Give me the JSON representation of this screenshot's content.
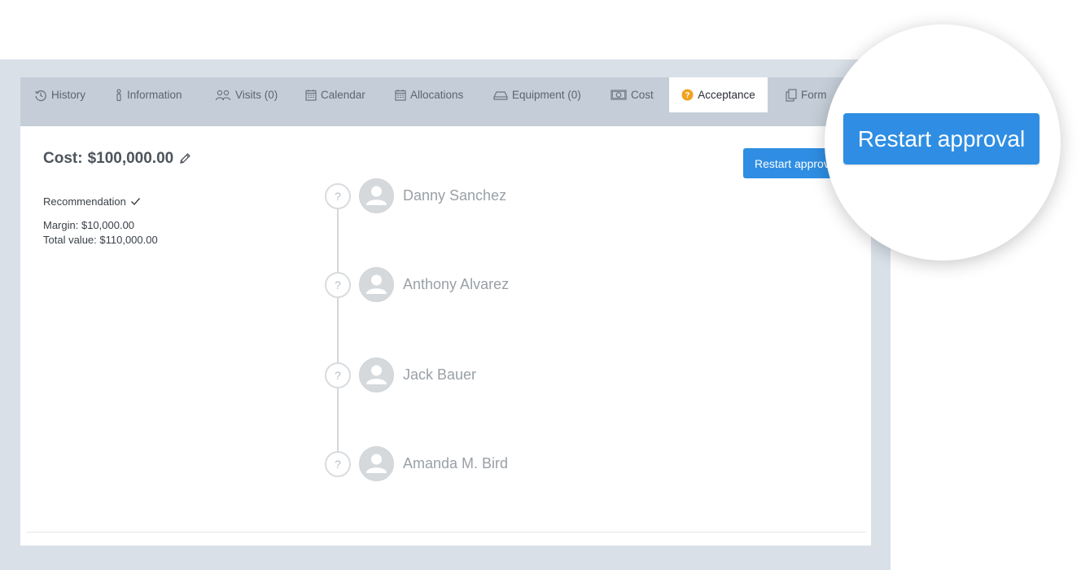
{
  "tabs": [
    {
      "label": "History",
      "icon": "history-icon"
    },
    {
      "label": "Information",
      "icon": "info-icon"
    },
    {
      "label": "Visits (0)",
      "icon": "users-icon"
    },
    {
      "label": "Calendar",
      "icon": "calendar-icon"
    },
    {
      "label": "Allocations",
      "icon": "calendar-grid-icon"
    },
    {
      "label": "Equipment (0)",
      "icon": "equipment-icon"
    },
    {
      "label": "Cost",
      "icon": "money-icon"
    },
    {
      "label": "Acceptance",
      "icon": "question-circle-icon",
      "active": true
    },
    {
      "label": "Form",
      "icon": "copy-icon"
    }
  ],
  "cost": {
    "label": "Cost:",
    "value": "$100,000.00",
    "recommendation": "Recommendation",
    "margin": "Margin: $10,000.00",
    "total": "Total value: $110,000.00"
  },
  "actions": {
    "restart_small": "Restart approval",
    "restart_big": "Restart approval"
  },
  "approvers": [
    {
      "name": "Danny Sanchez",
      "status": "?"
    },
    {
      "name": "Anthony Alvarez",
      "status": "?"
    },
    {
      "name": "Jack Bauer",
      "status": "?"
    },
    {
      "name": "Amanda M. Bird",
      "status": "?"
    }
  ],
  "colors": {
    "accent": "#2f8ee3",
    "acceptance_icon": "#f0a21f"
  }
}
